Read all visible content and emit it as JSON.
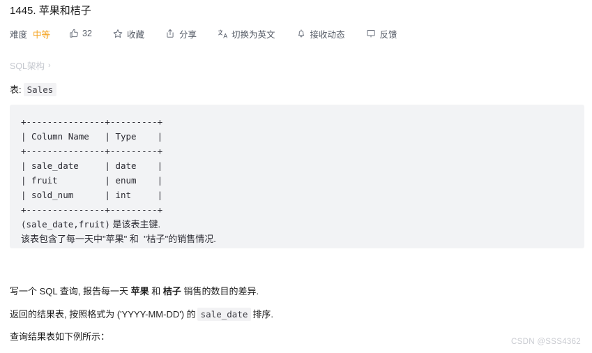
{
  "problem": {
    "title": "1445. 苹果和桔子"
  },
  "toolbar": {
    "difficulty_label": "难度",
    "difficulty_value": "中等",
    "difficulty_color": "#f5a524",
    "like_count": "32",
    "like_icon": "thumbs-up-icon",
    "favorite_label": "收藏",
    "favorite_icon": "star-icon",
    "share_label": "分享",
    "share_icon": "share-icon",
    "translate_label": "切换为英文",
    "translate_icon": "translate-icon",
    "subscribe_label": "接收动态",
    "subscribe_icon": "bell-icon",
    "feedback_label": "反馈",
    "feedback_icon": "comment-icon"
  },
  "breadcrumb": {
    "label": "SQL架构",
    "chevron": "›"
  },
  "table_caption": {
    "prefix": "表:",
    "table_name": "Sales"
  },
  "schema_block": {
    "ascii": "+---------------+---------+\n| Column Name   | Type    |\n+---------------+---------+\n| sale_date     | date    |\n| fruit         | enum    |\n| sold_num      | int     |\n+---------------+---------+",
    "note_1_code": "(sale_date,fruit)",
    "note_1_text": " 是该表主键.",
    "note_2": "该表包含了每一天中\"苹果\" 和  \"桔子\"的销售情况."
  },
  "description": {
    "line1_a": "写一个 SQL 查询, 报告每一天 ",
    "line1_b": "苹果",
    "line1_c": " 和 ",
    "line1_d": "桔子",
    "line1_e": " 销售的数目的差异.",
    "line2_a": "返回的结果表, 按照格式为 ('YYYY-MM-DD') 的",
    "line2_code": "sale_date",
    "line2_b": "排序.",
    "line3": "查询结果表如下例所示："
  },
  "watermark": {
    "text": "CSDN @SSS4362"
  }
}
